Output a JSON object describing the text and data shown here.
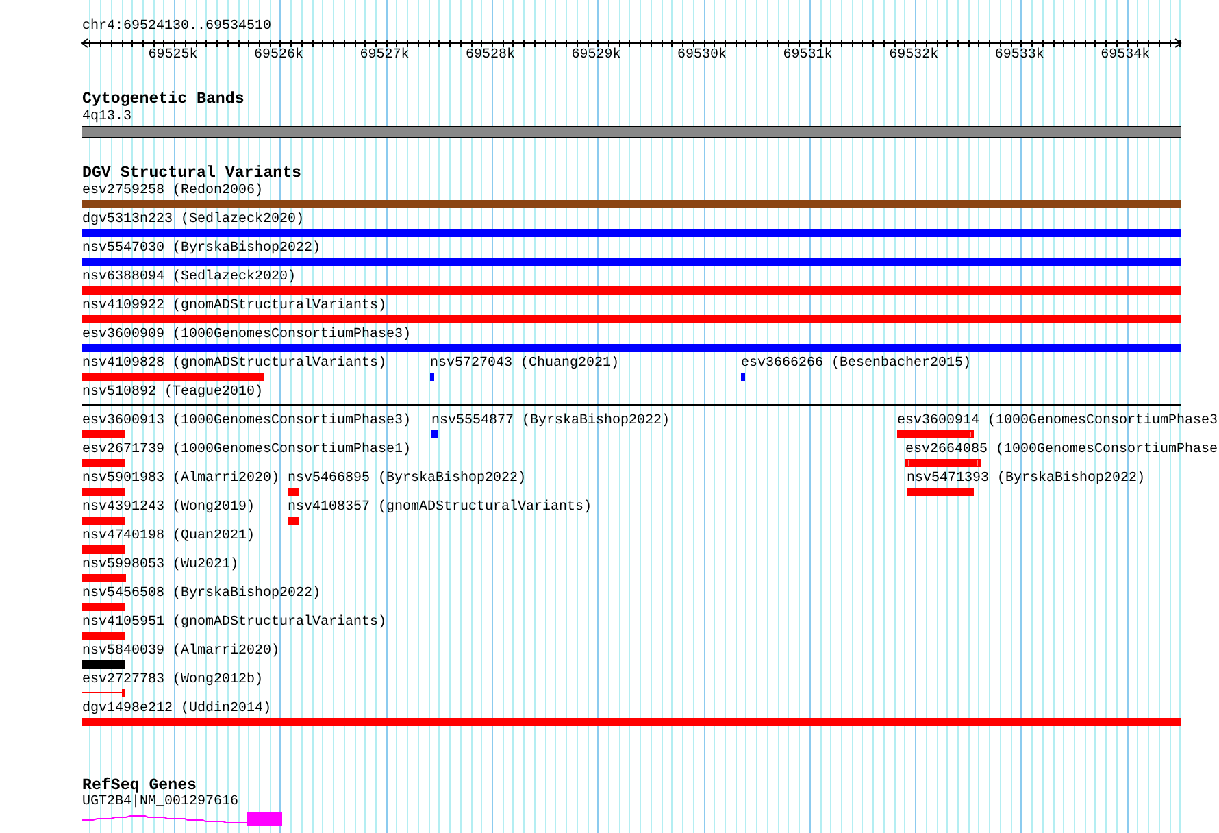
{
  "position": "chr4:69524130..69534510",
  "ruler_ticks": [
    "69525k",
    "69526k",
    "69527k",
    "69528k",
    "69529k",
    "69530k",
    "69531k",
    "69532k",
    "69533k",
    "69534k"
  ],
  "cytogenetic_bands": {
    "title": "Cytogenetic Bands",
    "band": "4q13.3"
  },
  "dgv_structural_variants": {
    "title": "DGV Structural Variants",
    "lanes": [
      {
        "features": [
          {
            "label": "esv2759258 (Redon2006)",
            "color": "#8b4513"
          }
        ]
      },
      {
        "features": [
          {
            "label": "dgv5313n223 (Sedlazeck2020)",
            "color": "#0000ff"
          }
        ]
      },
      {
        "features": [
          {
            "label": "nsv5547030 (ByrskaBishop2022)",
            "color": "#0000ff"
          }
        ]
      },
      {
        "features": [
          {
            "label": "nsv6388094 (Sedlazeck2020)",
            "color": "#ff0000"
          }
        ]
      },
      {
        "features": [
          {
            "label": "nsv4109922 (gnomADStructuralVariants)",
            "color": "#ff0000"
          }
        ]
      },
      {
        "features": [
          {
            "label": "esv3600909 (1000GenomesConsortiumPhase3)",
            "color": "#0000ff"
          }
        ]
      },
      {
        "features": [
          {
            "label": "nsv4109828 (gnomADStructuralVariants)",
            "color": "#ff0000"
          },
          {
            "label": "nsv5727043 (Chuang2021)",
            "color": "#0000ff"
          },
          {
            "label": "esv3666266 (Besenbacher2015)",
            "color": "#0000ff"
          }
        ]
      },
      {
        "features": [
          {
            "label": "nsv510892 (Teague2010)"
          }
        ]
      },
      {
        "features": [
          {
            "label": "esv3600913 (1000GenomesConsortiumPhase3)",
            "color": "#ff0000"
          },
          {
            "label": "nsv5554877 (ByrskaBishop2022)",
            "color": "#0000ff"
          },
          {
            "label": "esv3600914 (1000GenomesConsortiumPhase3",
            "color": "#ff0000"
          }
        ]
      },
      {
        "features": [
          {
            "label": "esv2671739 (1000GenomesConsortiumPhase1)",
            "color": "#ff0000"
          },
          {
            "label": "esv2664085 (1000GenomesConsortiumPhase",
            "color": "#ff0000"
          }
        ]
      },
      {
        "features": [
          {
            "label": "nsv5901983 (Almarri2020)",
            "color": "#ff0000"
          },
          {
            "label": "nsv5466895 (ByrskaBishop2022)",
            "color": "#ff0000"
          },
          {
            "label": "nsv5471393 (ByrskaBishop2022)",
            "color": "#ff0000"
          }
        ]
      },
      {
        "features": [
          {
            "label": "nsv4391243 (Wong2019)",
            "color": "#ff0000"
          },
          {
            "label": "nsv4108357 (gnomADStructuralVariants)",
            "color": "#ff0000"
          }
        ]
      },
      {
        "features": [
          {
            "label": "nsv4740198 (Quan2021)",
            "color": "#ff0000"
          }
        ]
      },
      {
        "features": [
          {
            "label": "nsv5998053 (Wu2021)",
            "color": "#ff0000"
          }
        ]
      },
      {
        "features": [
          {
            "label": "nsv5456508 (ByrskaBishop2022)",
            "color": "#ff0000"
          }
        ]
      },
      {
        "features": [
          {
            "label": "nsv4105951 (gnomADStructuralVariants)",
            "color": "#ff0000"
          }
        ]
      },
      {
        "features": [
          {
            "label": "nsv5840039 (Almarri2020)",
            "color": "#000000"
          }
        ]
      },
      {
        "features": [
          {
            "label": "esv2727783 (Wong2012b)",
            "color": "#ff0000"
          }
        ]
      },
      {
        "features": [
          {
            "label": "dgv1498e212 (Uddin2014)",
            "color": "#ff0000"
          }
        ]
      }
    ]
  },
  "refseq_genes": {
    "title": "RefSeq Genes",
    "genes": [
      {
        "label": "UGT2B4|NM_001297616"
      }
    ]
  }
}
